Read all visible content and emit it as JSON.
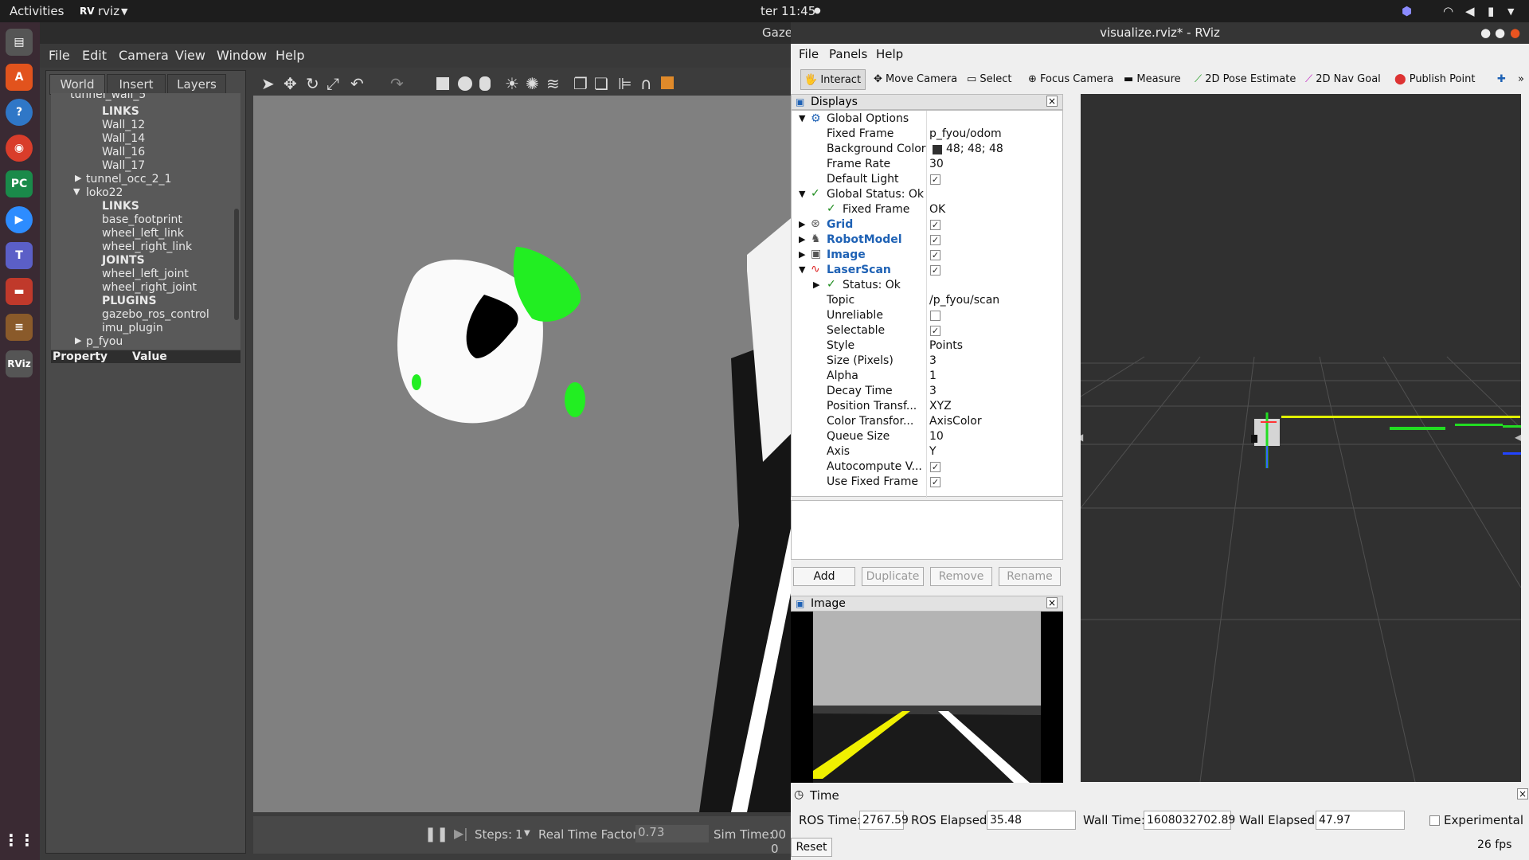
{
  "topbar": {
    "activities": "Activities",
    "app": "rviz",
    "clock": "ter 11:45"
  },
  "gazebo": {
    "title": "Gaze",
    "menu": [
      "File",
      "Edit",
      "Camera",
      "View",
      "Window",
      "Help"
    ],
    "tabs": [
      "World",
      "Insert",
      "Layers"
    ],
    "tree": [
      "tunnel_wall_5",
      "LINKS",
      "Wall_12",
      "Wall_14",
      "Wall_16",
      "Wall_17",
      "tunnel_occ_2_1",
      "loko22",
      "LINKS",
      "base_footprint",
      "wheel_left_link",
      "wheel_right_link",
      "JOINTS",
      "wheel_left_joint",
      "wheel_right_joint",
      "PLUGINS",
      "gazebo_ros_control",
      "imu_plugin",
      "p_fyou"
    ],
    "prop_header": [
      "Property",
      "Value"
    ],
    "bottom": {
      "steps_label": "Steps:",
      "steps_value": "1",
      "rtf_label": "Real Time Factor:",
      "rtf_value": "0.73",
      "sim_label": "Sim Time:",
      "sim_value": "00 0"
    }
  },
  "rviz": {
    "title": "visualize.rviz* - RViz",
    "menu": [
      "File",
      "Panels",
      "Help"
    ],
    "tools": [
      "Interact",
      "Move Camera",
      "Select",
      "Focus Camera",
      "Measure",
      "2D Pose Estimate",
      "2D Nav Goal",
      "Publish Point"
    ],
    "displays_title": "Displays",
    "rows": [
      {
        "name": "Global Options",
        "value": ""
      },
      {
        "name": "Fixed Frame",
        "value": "p_fyou/odom"
      },
      {
        "name": "Background Color",
        "value": "48; 48; 48"
      },
      {
        "name": "Frame Rate",
        "value": "30"
      },
      {
        "name": "Default Light",
        "value": ""
      },
      {
        "name": "Global Status: Ok",
        "value": ""
      },
      {
        "name": "Fixed Frame",
        "value": "OK"
      },
      {
        "name": "Grid",
        "value": ""
      },
      {
        "name": "RobotModel",
        "value": ""
      },
      {
        "name": "Image",
        "value": ""
      },
      {
        "name": "LaserScan",
        "value": ""
      },
      {
        "name": "Status: Ok",
        "value": ""
      },
      {
        "name": "Topic",
        "value": "/p_fyou/scan"
      },
      {
        "name": "Unreliable",
        "value": ""
      },
      {
        "name": "Selectable",
        "value": ""
      },
      {
        "name": "Style",
        "value": "Points"
      },
      {
        "name": "Size (Pixels)",
        "value": "3"
      },
      {
        "name": "Alpha",
        "value": "1"
      },
      {
        "name": "Decay Time",
        "value": "3"
      },
      {
        "name": "Position Transf...",
        "value": "XYZ"
      },
      {
        "name": "Color Transfor...",
        "value": "AxisColor"
      },
      {
        "name": "Queue Size",
        "value": "10"
      },
      {
        "name": "Axis",
        "value": "Y"
      },
      {
        "name": "Autocompute V...",
        "value": ""
      },
      {
        "name": "Use Fixed Frame",
        "value": ""
      }
    ],
    "buttons": [
      "Add",
      "Duplicate",
      "Remove",
      "Rename"
    ],
    "image_title": "Image",
    "time": {
      "title": "Time",
      "ros_time_label": "ROS Time:",
      "ros_time": "2767.59",
      "ros_elapsed_label": "ROS Elapsed:",
      "ros_elapsed": "35.48",
      "wall_time_label": "Wall Time:",
      "wall_time": "1608032702.89",
      "wall_elapsed_label": "Wall Elapsed:",
      "wall_elapsed": "47.97",
      "experimental": "Experimental",
      "reset": "Reset",
      "fps": "26 fps"
    }
  }
}
